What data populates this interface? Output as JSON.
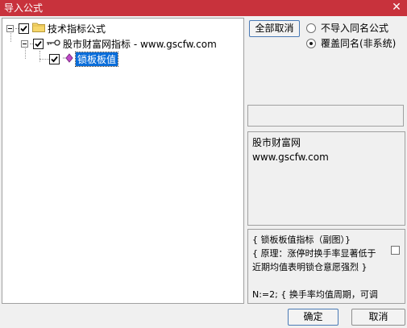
{
  "window": {
    "title": "导入公式",
    "close_glyph": "✕"
  },
  "tree": {
    "root": {
      "label": "技术指标公式",
      "checked": true
    },
    "child": {
      "label": "股市财富网指标 - www.gscfw.com",
      "checked": true
    },
    "leaf": {
      "label": "锁板板值",
      "checked": true,
      "selected": true
    }
  },
  "actions": {
    "deselect_all": "全部取消"
  },
  "options": {
    "skip_same_name": "不导入同名公式",
    "overwrite_same_name": "覆盖同名(非系统)",
    "selected": "overwrite_same_name"
  },
  "info": {
    "line1": "股市财富网",
    "line2": "www.gscfw.com"
  },
  "description": {
    "line1": "{ 锁板板值指标（副图）}",
    "line2": "{ 原理：涨停时换手率显著低于",
    "line3": "近期均值表明锁仓意愿强烈 }",
    "line4": "",
    "line5": "N:=2; { 换手率均值周期，可调"
  },
  "footer": {
    "ok": "确定",
    "cancel": "取消"
  },
  "colors": {
    "titlebar": "#c8323c",
    "selection": "#0a6dd9"
  }
}
